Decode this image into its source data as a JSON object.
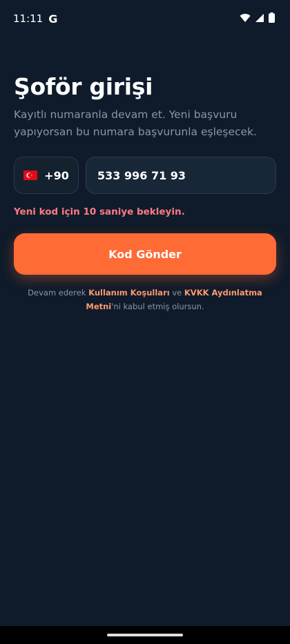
{
  "status_bar": {
    "time": "11:11",
    "g_logo": "G",
    "wifi_icon": "wifi-icon",
    "signal_icon": "signal-icon",
    "battery_icon": "battery-icon"
  },
  "header": {
    "title": "Şoför girişi",
    "subtitle": "Kayıtlı numaranla devam et. Yeni başvuru yapıyorsan bu numara başvurunla eşleşecek."
  },
  "form": {
    "country_flag": "turkey-flag-icon",
    "dial_code": "+90",
    "phone_value": "533 996 71 93",
    "warning": "Yeni kod için 10 saniye bekleyin.",
    "send_button_label": "Kod Gönder"
  },
  "legal": {
    "prefix": "Devam ederek ",
    "terms_link": "Kullanım Koşulları",
    "middle": " ve ",
    "kvkk_link": "KVKK Aydınlatma Metni",
    "suffix": "'ni kabul etmiş olursun."
  },
  "colors": {
    "background": "#0f1b2a",
    "accent": "#ff6b35",
    "warning": "#ff7b86",
    "link": "#ff9a6e",
    "muted_text": "#8a96a6"
  }
}
